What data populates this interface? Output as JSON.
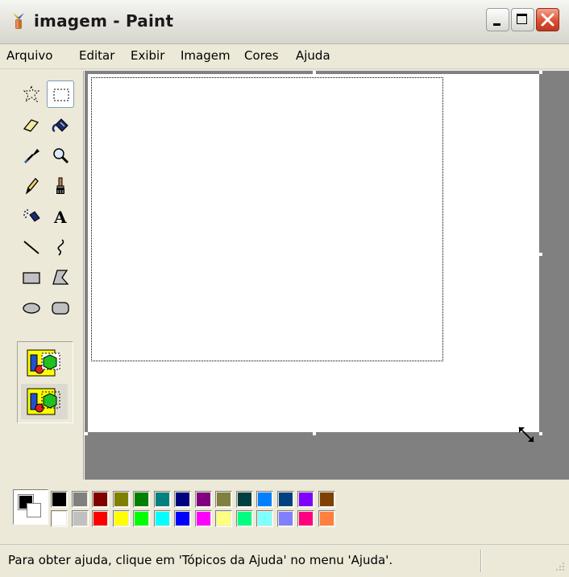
{
  "window": {
    "title": "imagem - Paint",
    "controls": {
      "minimize": "minimize-button",
      "maximize": "maximize-button",
      "close": "close-button"
    }
  },
  "menu": {
    "items": [
      "Arquivo",
      "Editar",
      "Exibir",
      "Imagem",
      "Cores",
      "Ajuda"
    ]
  },
  "tools": [
    "free-form-select-icon",
    "select-icon",
    "eraser-icon",
    "fill-icon",
    "pick-color-icon",
    "magnifier-icon",
    "pencil-icon",
    "brush-icon",
    "airbrush-icon",
    "text-icon",
    "line-icon",
    "curve-icon",
    "rectangle-icon",
    "polygon-icon",
    "ellipse-icon",
    "rounded-rectangle-icon"
  ],
  "selected_tool": "select-icon",
  "options": [
    "opaque-selection-icon",
    "transparent-selection-icon"
  ],
  "colors": {
    "foreground": "#000000",
    "background": "#ffffff",
    "palette_top": [
      "#000000",
      "#808080",
      "#800000",
      "#808000",
      "#008000",
      "#008080",
      "#000080",
      "#800080",
      "#808040",
      "#004040",
      "#0080ff",
      "#004080",
      "#8000ff",
      "#804000"
    ],
    "palette_bottom": [
      "#ffffff",
      "#c0c0c0",
      "#ff0000",
      "#ffff00",
      "#00ff00",
      "#00ffff",
      "#0000ff",
      "#ff00ff",
      "#ffff80",
      "#00ff80",
      "#80ffff",
      "#8080ff",
      "#ff0080",
      "#ff8040"
    ]
  },
  "status": {
    "help_text": "Para obter ajuda, clique em 'Tópicos da Ajuda' no menu 'Ajuda'."
  }
}
